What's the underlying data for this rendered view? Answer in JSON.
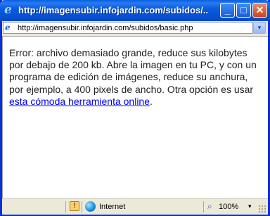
{
  "window": {
    "title": "http://imagensubir.infojardin.com/subidos/...",
    "buttons": {
      "minimize": "_",
      "maximize": "□",
      "close": "✕"
    }
  },
  "address_bar": {
    "url": "http://imagensubir.infojardin.com/subidos/basic.php",
    "icon": "ie-page-icon",
    "dropdown": "▾"
  },
  "content": {
    "message_text": "Error: archivo demasiado grande, reduce sus kilobytes por debajo de 200 kb. Abre la imagen en tu PC, y con un programa de edición de imágenes, reduce su anchura, por ejemplo, a 400 pixels de ancho. Otra opción es usar ",
    "link_text": "esta cómoda herramienta online",
    "trailing_text": "."
  },
  "status_bar": {
    "zone": "Internet",
    "zoom": "100%",
    "zoom_arrow": "▾",
    "security_icon": "security-warning-icon",
    "zone_icon": "globe-icon"
  },
  "colors": {
    "titlebar": "#0553d6",
    "link": "#0000ee",
    "text": "#222222"
  }
}
